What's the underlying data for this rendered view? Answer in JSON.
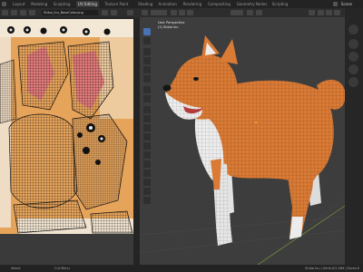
{
  "workspace_tabs": [
    "Layout",
    "Modeling",
    "Sculpting",
    "UV Editing",
    "Texture Paint",
    "Shading",
    "Animation",
    "Rendering",
    "Compositing",
    "Geometry Nodes",
    "Scripting"
  ],
  "active_tab_index": 3,
  "scene_label": "Scene",
  "uv_editor": {
    "image_name": "Shiba_Inu_BaseColor.png",
    "view_menu": "View"
  },
  "viewport": {
    "mode": "Edit Mode",
    "shading": "Normal",
    "info_line1": "User Perspective",
    "info_line2": "(1) Shiba Inu"
  },
  "status_bar": {
    "left": "Select",
    "middle": "Cut Menu",
    "right": "Shiba Inu | Verts:0/1,066 | Faces:0"
  },
  "colors": {
    "accent": "#4772b3",
    "fur_orange": "#d97a35",
    "uv_orange": "#e8a456"
  }
}
